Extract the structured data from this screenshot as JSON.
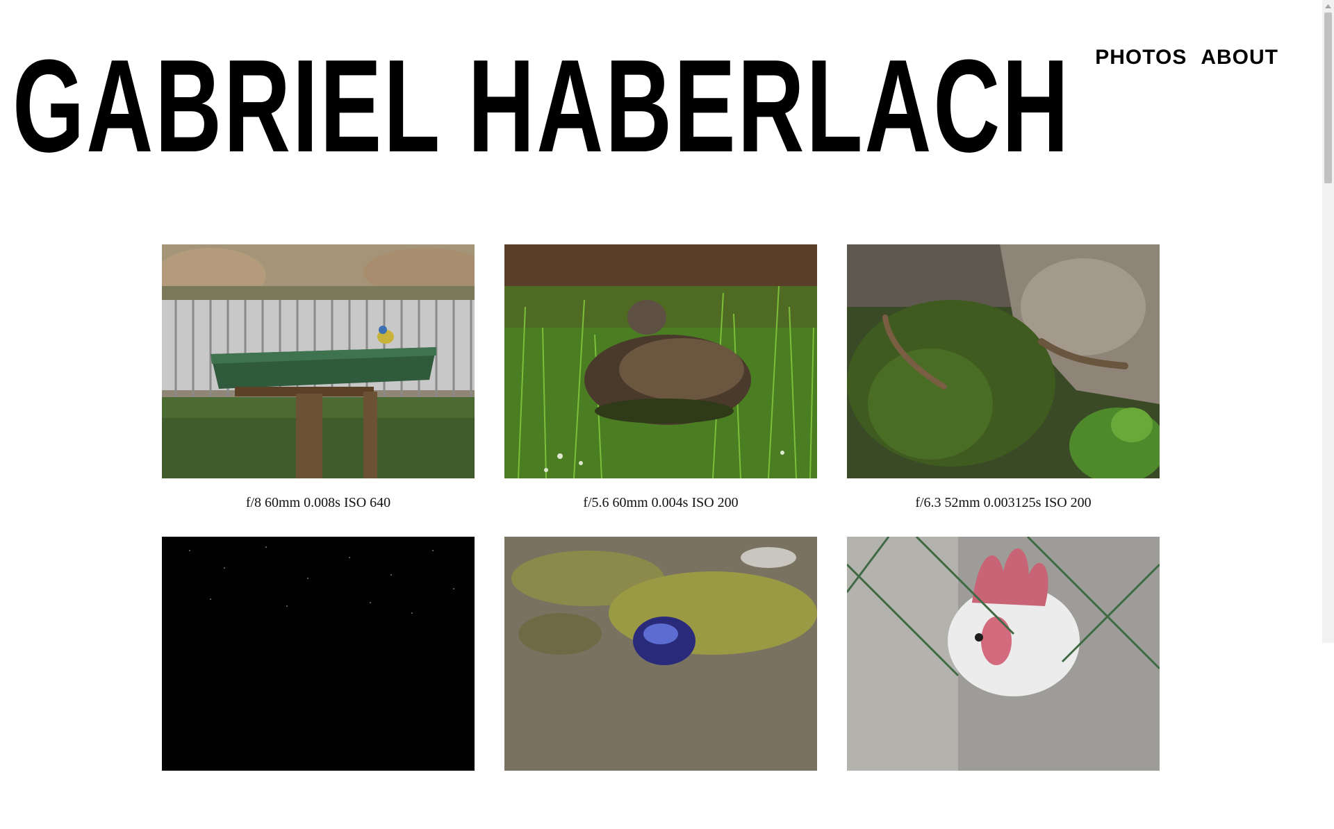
{
  "site": {
    "title": "GABRIEL HABERLACH"
  },
  "nav": {
    "photos": "PHOTOS",
    "about": "ABOUT"
  },
  "gallery": {
    "items": [
      {
        "caption": "f/8 60mm 0.008s ISO 640",
        "subject": "blue tit on bird feeder in vineyard"
      },
      {
        "caption": "f/5.6 60mm 0.004s ISO 200",
        "subject": "duck resting in grass"
      },
      {
        "caption": "f/6.3 52mm 0.003125s ISO 200",
        "subject": "lizards on mossy rock"
      },
      {
        "caption": "",
        "subject": "starry night sky"
      },
      {
        "caption": "",
        "subject": "iridescent beetle on lichen"
      },
      {
        "caption": "",
        "subject": "rooster behind wire fence"
      }
    ]
  }
}
